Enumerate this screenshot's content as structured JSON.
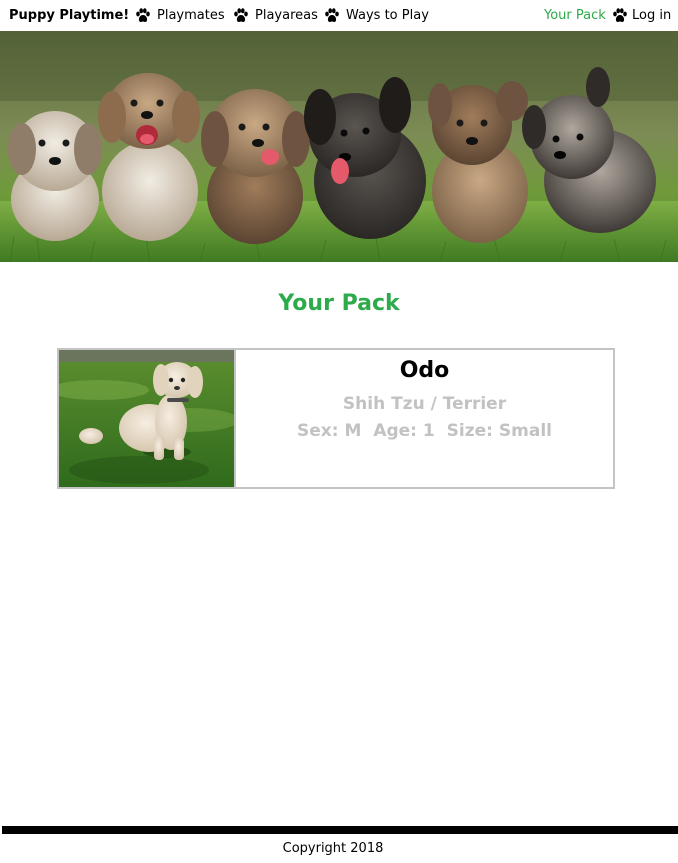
{
  "navbar": {
    "brand": "Puppy Playtime!",
    "links": [
      {
        "label": "Playmates",
        "icon": "paw-icon"
      },
      {
        "label": "Playareas",
        "icon": "paw-icon"
      },
      {
        "label": "Ways to Play",
        "icon": "paw-icon"
      }
    ],
    "right_links": [
      {
        "label": "Your Pack",
        "active": true
      },
      {
        "label": "Log in",
        "icon": "paw-icon"
      }
    ],
    "active_color": "#2daa4a"
  },
  "hero": {
    "image": "puppies-running-banner"
  },
  "page": {
    "title": "Your Pack"
  },
  "pack": [
    {
      "name": "Odo",
      "breed": "Shih Tzu / Terrier",
      "sex_label": "Sex:",
      "sex": "M",
      "age_label": "Age:",
      "age": "1",
      "size_label": "Size:",
      "size": "Small",
      "photo": "white-dog-on-grass-photo"
    }
  ],
  "footer": {
    "copyright": "Copyright 2018"
  }
}
